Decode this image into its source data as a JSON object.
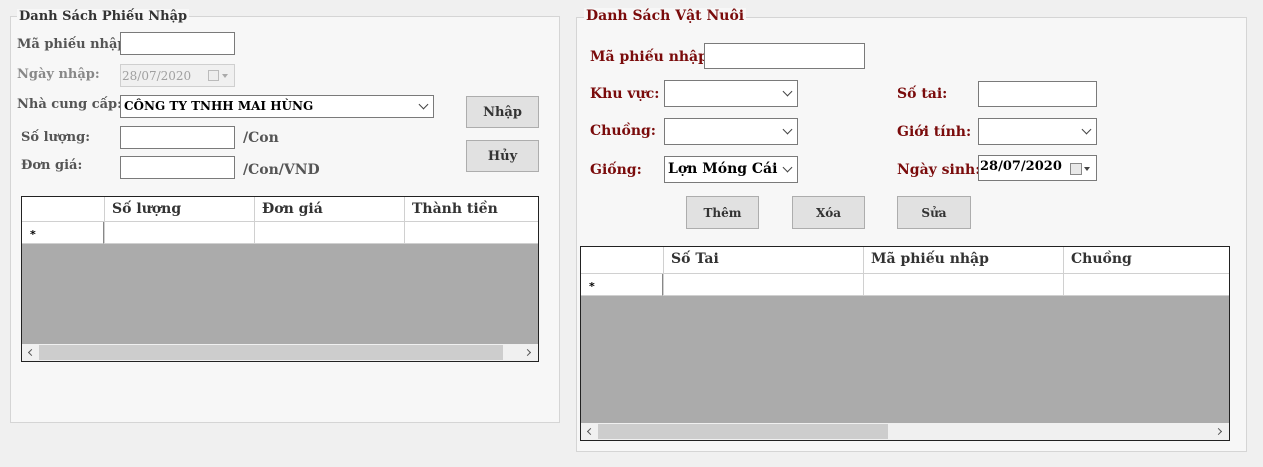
{
  "left_panel": {
    "title": "Danh Sách Phiếu Nhập",
    "ma_phieu_label": "Mã phiếu nhập:",
    "ma_phieu_value": "",
    "ngay_nhap_label": "Ngày nhập:",
    "ngay_nhap_value": "28/07/2020",
    "nha_cung_cap_label": "Nhà cung cấp:",
    "nha_cung_cap_value": "CÔNG TY TNHH MAI HÙNG",
    "so_luong_label": "Số lượng:",
    "so_luong_value": "",
    "so_luong_unit": "/Con",
    "don_gia_label": "Đơn giá:",
    "don_gia_value": "",
    "don_gia_unit": "/Con/VND",
    "nhap_button": "Nhập",
    "huy_button": "Hủy",
    "grid": {
      "columns": [
        "Số lượng",
        "Đơn giá",
        "Thành tiền"
      ],
      "new_row_marker": "*"
    }
  },
  "right_panel": {
    "title": "Danh Sách Vật Nuôi",
    "ma_phieu_label": "Mã phiếu nhập:",
    "ma_phieu_value": "",
    "khu_vuc_label": "Khu vực:",
    "khu_vuc_value": "",
    "so_tai_label": "Số tai:",
    "so_tai_value": "",
    "chuong_label": "Chuồng:",
    "chuong_value": "",
    "gioi_tinh_label": "Giới tính:",
    "gioi_tinh_value": "",
    "giong_label": "Giống:",
    "giong_value": "Lợn Móng Cái",
    "ngay_sinh_label": "Ngày sinh:",
    "ngay_sinh_value": "28/07/2020",
    "them_button": "Thêm",
    "xoa_button": "Xóa",
    "sua_button": "Sửa",
    "grid": {
      "columns": [
        "Số Tai",
        "Mã phiếu nhập",
        "Chuồng"
      ],
      "new_row_marker": "*"
    }
  }
}
